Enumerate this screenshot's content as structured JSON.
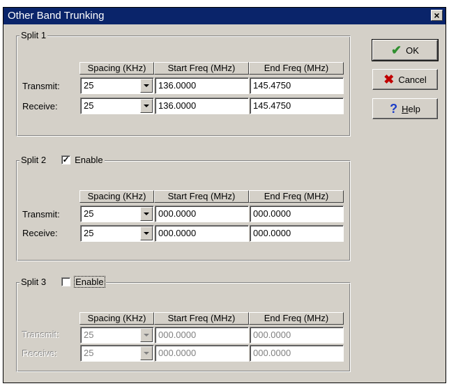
{
  "window": {
    "title": "Other Band Trunking",
    "close_glyph": "×"
  },
  "buttons": {
    "ok": {
      "label": "OK",
      "icon": "checkmark-icon"
    },
    "cancel": {
      "label": "Cancel",
      "icon": "x-icon"
    },
    "help": {
      "label": "Help",
      "mnemonic": "H",
      "rest": "elp",
      "icon": "question-icon"
    }
  },
  "columns": {
    "spacing": "Spacing (KHz)",
    "start": "Start Freq (MHz)",
    "end": "End Freq (MHz)"
  },
  "rows": {
    "transmit": "Transmit:",
    "receive": "Receive:"
  },
  "splits": [
    {
      "label": "Split 1",
      "transmit": {
        "spacing": "25",
        "start": "136.0000",
        "end": "145.4750"
      },
      "receive": {
        "spacing": "25",
        "start": "136.0000",
        "end": "145.4750"
      }
    },
    {
      "label": "Split 2",
      "enable_label": "Enable",
      "enabled": true,
      "check_glyph": "✓",
      "transmit": {
        "spacing": "25",
        "start": "000.0000",
        "end": "000.0000"
      },
      "receive": {
        "spacing": "25",
        "start": "000.0000",
        "end": "000.0000"
      }
    },
    {
      "label": "Split 3",
      "enable_label": "Enable",
      "enabled": false,
      "check_glyph": "",
      "transmit": {
        "spacing": "25",
        "start": "000.0000",
        "end": "000.0000"
      },
      "receive": {
        "spacing": "25",
        "start": "000.0000",
        "end": "000.0000"
      }
    }
  ],
  "colors": {
    "title_bar": "#0a246a",
    "face": "#d4d0c8",
    "ok_icon": "#2f8f2f",
    "cancel_icon": "#c00000",
    "help_icon": "#1a3cc8"
  }
}
